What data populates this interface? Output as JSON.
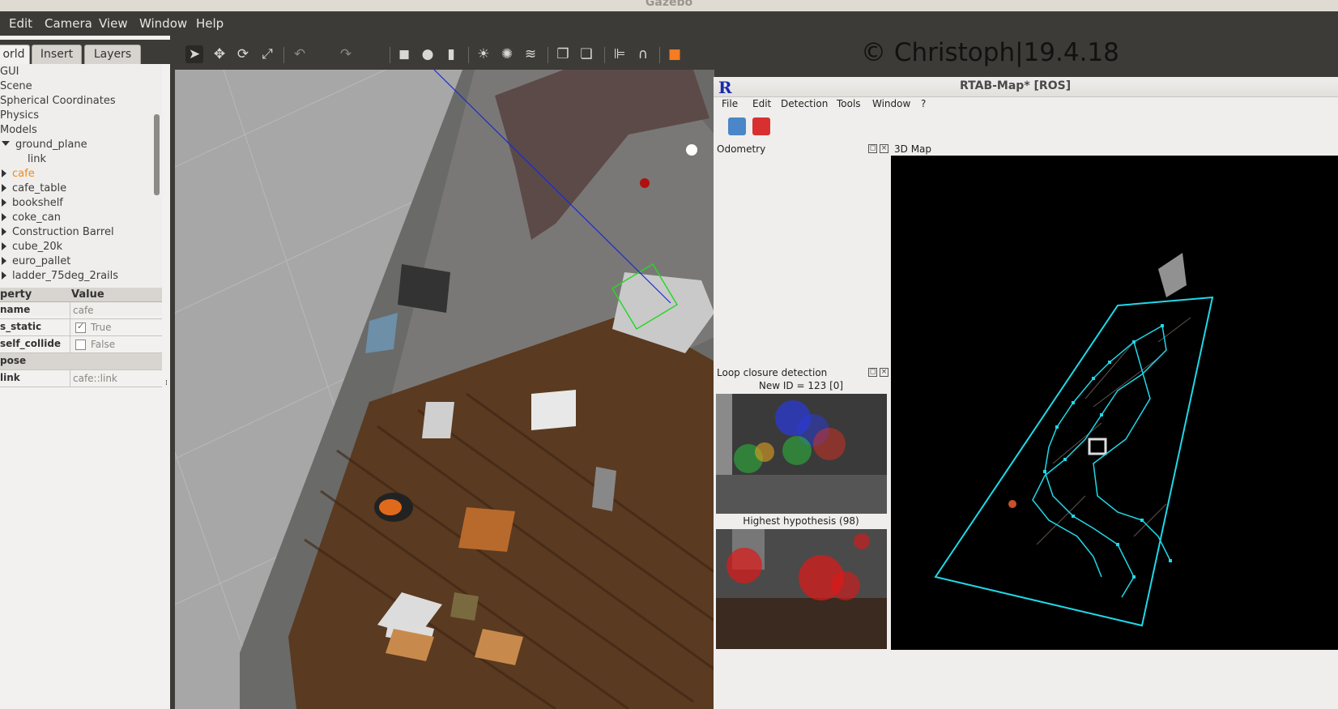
{
  "window_title": "Gazebo",
  "menu": [
    "Edit",
    "Camera",
    "View",
    "Window",
    "Help"
  ],
  "left_tabs": [
    "orld",
    "Insert",
    "Layers"
  ],
  "tree": {
    "top_items": [
      "GUI",
      "Scene",
      "Spherical Coordinates",
      "Physics",
      "Models"
    ],
    "expanded_model": "ground_plane",
    "expanded_child": "link",
    "models": [
      "cafe",
      "cafe_table",
      "bookshelf",
      "coke_can",
      "Construction Barrel",
      "cube_20k",
      "euro_pallet",
      "ladder_75deg_2rails"
    ],
    "selected": "cafe"
  },
  "properties": {
    "header_property": "perty",
    "header_value": "Value",
    "rows": [
      {
        "key": "name",
        "value": "cafe"
      },
      {
        "key": "s_static",
        "value": "True",
        "checked": true
      },
      {
        "key": "self_collide",
        "value": "False",
        "checked": false
      }
    ],
    "group_pose": "pose",
    "link_key": "link",
    "link_value": "cafe::link"
  },
  "toolbar_icons": [
    "select-arrow-icon",
    "translate-icon",
    "rotate-icon",
    "scale-icon",
    "undo-icon",
    "redo-icon",
    "box-icon",
    "sphere-icon",
    "cylinder-icon",
    "point-light-icon",
    "spot-light-icon",
    "directional-light-icon",
    "copy-icon",
    "paste-icon",
    "align-icon",
    "magnet-icon",
    "view-angle-icon"
  ],
  "watermark": "© Christoph|19.4.18",
  "rtabmap": {
    "logo": "R",
    "title": "RTAB-Map* [ROS]",
    "menu": [
      "File",
      "Edit",
      "Detection",
      "Tools",
      "Window",
      "?"
    ],
    "odometry": "Odometry",
    "loop_closure": "Loop closure detection",
    "new_id": "New ID = 123 [0]",
    "highest_hypothesis": "Highest hypothesis (98)",
    "map_3d": "3D Map"
  },
  "colors": {
    "selected": "#f08a19",
    "map_graph": "#20d8e8",
    "rtab_logo": "#1b2aa8"
  }
}
